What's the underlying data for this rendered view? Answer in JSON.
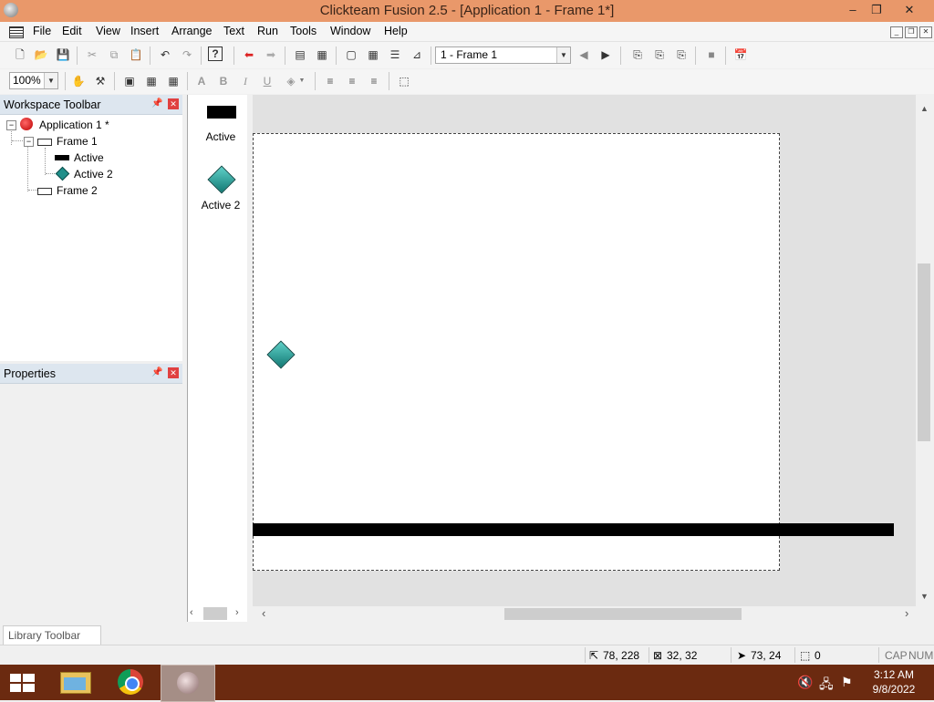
{
  "window": {
    "title": "Clickteam Fusion 2.5 - [Application 1 - Frame 1*]",
    "minimize_glyph": "–",
    "restore_glyph": "❐",
    "close_glyph": "✕"
  },
  "menu": {
    "items": [
      "File",
      "Edit",
      "View",
      "Insert",
      "Arrange",
      "Text",
      "Run",
      "Tools",
      "Window",
      "Help"
    ]
  },
  "toolbar": {
    "frame_select": "1 - Frame 1",
    "zoom": "100%"
  },
  "workspace": {
    "title": "Workspace Toolbar",
    "tree": {
      "application": "Application 1 *",
      "frame1": "Frame 1",
      "active": "Active",
      "active2": "Active 2",
      "frame2": "Frame 2"
    }
  },
  "properties": {
    "title": "Properties"
  },
  "object_shelf": {
    "items": [
      "Active",
      "Active 2"
    ]
  },
  "library": {
    "title": "Library Toolbar"
  },
  "status": {
    "position": "78, 228",
    "size": "32, 32",
    "mouse": "73, 24",
    "count": "0",
    "caps": "CAP",
    "num": "NUM"
  },
  "taskbar": {
    "time": "3:12 AM",
    "date": "9/8/2022"
  },
  "colors": {
    "titlebar": "#e9986a",
    "taskbar": "#6b2a10",
    "diamond": "#1f8f8a",
    "close_red": "#e04040"
  }
}
